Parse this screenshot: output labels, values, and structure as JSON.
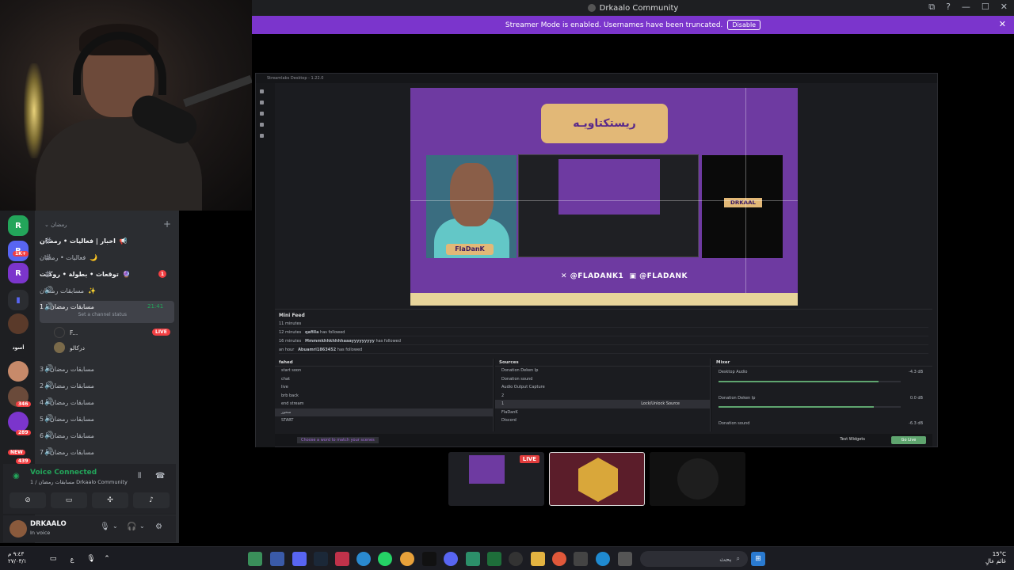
{
  "window": {
    "title": "Drkaalo Community",
    "controls": [
      "⧉",
      "?",
      "—",
      "☐",
      "✕"
    ]
  },
  "banner": {
    "text": "Streamer Mode is enabled. Usernames have been truncated.",
    "button": "Disable"
  },
  "obs": {
    "title": "Streamlabs Desktop - 1.22.0",
    "preview": {
      "logo_text": "ريستكتاويـه",
      "cam_label": "FlaDanK",
      "right_label": "DRKAAL",
      "social_1": "@FLADANK1",
      "social_2": "@FLADANK"
    },
    "minifeed": {
      "header": "Mini Feed",
      "rows": [
        {
          "time": "11 minutes",
          "name": "",
          "action": ""
        },
        {
          "time": "12 minutes",
          "name": "qafilla",
          "action": "has followed"
        },
        {
          "time": "16 minutes",
          "name": "Mmmmkhhkhhhhaaayyyyyyyyy",
          "action": "has followed"
        },
        {
          "time": "an hour",
          "name": "Abuamri1863452",
          "action": "has followed"
        }
      ]
    },
    "scenes": {
      "header": "fahed",
      "items": [
        "start soon",
        "chat",
        "live",
        "brb back",
        "end stream",
        "سحور",
        "START"
      ]
    },
    "sources": {
      "header": "Sources",
      "items": [
        "Donation Deken Ip",
        "Donation sound",
        "Audio Output Capture",
        "2",
        "1",
        "FlaDanK",
        "Discord"
      ],
      "tooltip": "Lock/Unlock Source"
    },
    "mixer": {
      "header": "Mixer",
      "items": [
        {
          "name": "Desktop Audio",
          "db": "-4.3 dB",
          "level": 0.88
        },
        {
          "name": "Donation Deken Ip",
          "db": "0.0 dB",
          "level": 0.85
        },
        {
          "name": "Donation sound",
          "db": "-6.3 dB",
          "level": 0.5
        }
      ]
    },
    "footer": {
      "hint": "Choose a word to match your scenes",
      "test_widgets": "Test Widgets",
      "go_live": "Go Live"
    }
  },
  "thumbs": {
    "live": "LIVE"
  },
  "discord": {
    "category": "رمضان",
    "channels": [
      {
        "type": "text",
        "name": "اخبار | فعاليات • رمضان",
        "emoji": "📢",
        "bright": true
      },
      {
        "type": "text",
        "name": "فعاليات • رمضان",
        "emoji": "🌙",
        "bright": false
      },
      {
        "type": "text",
        "name": "توقعات • بطولة • روكيت",
        "emoji": "🔮",
        "bright": true,
        "badge": "1"
      },
      {
        "type": "voice",
        "name": "مسابقات رمضان",
        "emoji": "✨",
        "bright": false
      }
    ],
    "active_channel": {
      "name": "مسابقات رمضان | 1",
      "time": "21:41",
      "status": "Set a channel status"
    },
    "voice_users": [
      {
        "name": "F..."
      },
      {
        "name": "دركالو"
      }
    ],
    "live_pill": "LIVE",
    "voice_channels": [
      "مسابقات رمضان | 3",
      "مسابقات رمضان | 2",
      "مسابقات رمضان | 4",
      "مسابقات رمضان | 5",
      "مسابقات رمضان | 6",
      "مسابقات رمضان | 7"
    ],
    "server_badges": [
      "1K+",
      "346",
      "289",
      "NEW",
      "439"
    ],
    "voice": {
      "status": "Voice Connected",
      "sub": "مسابقات رمضان / 1 Drkaalo Community"
    },
    "user": {
      "name": "DRKAALO",
      "status": "In voice"
    }
  },
  "taskbar": {
    "search": "بحث",
    "clock_time": "٩:٤٣ م",
    "clock_date": "٢٧/٠٣/١",
    "weather_temp": "15°C",
    "weather_text": "غائم عالٍ",
    "lang": "ع"
  }
}
